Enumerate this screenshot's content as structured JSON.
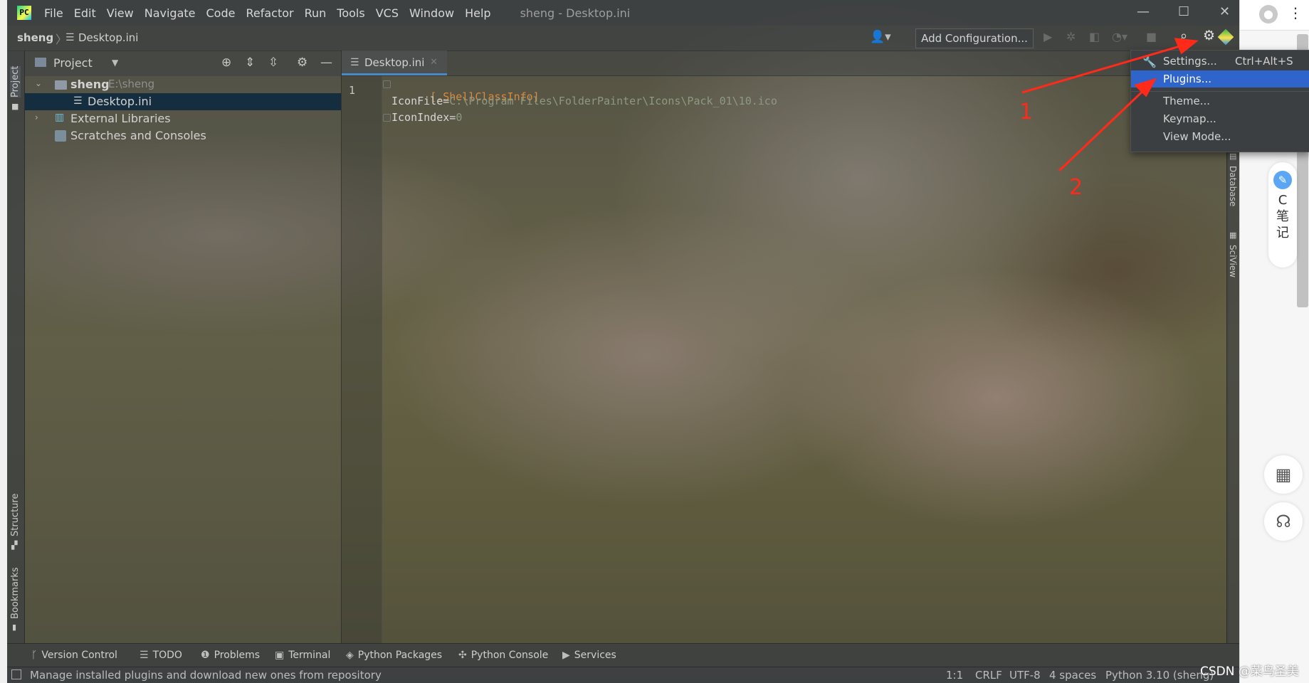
{
  "window": {
    "title": "sheng - Desktop.ini",
    "app_logo": "PC",
    "minimize": "—",
    "maximize": "☐",
    "close": "✕"
  },
  "menu": [
    "File",
    "Edit",
    "View",
    "Navigate",
    "Code",
    "Refactor",
    "Run",
    "Tools",
    "VCS",
    "Window",
    "Help"
  ],
  "navbar": {
    "root": "sheng",
    "file": "Desktop.ini",
    "add_configuration": "Add Configuration..."
  },
  "left_strip": {
    "project": "Project",
    "structure": "Structure",
    "bookmarks": "Bookmarks"
  },
  "project_panel": {
    "title": "Project",
    "tree": [
      {
        "label": "sheng",
        "path": "E:\\sheng"
      },
      {
        "label": "Desktop.ini"
      },
      {
        "label": "External Libraries"
      },
      {
        "label": "Scratches and Consoles"
      }
    ]
  },
  "editor": {
    "tab_label": "Desktop.ini",
    "line_number": "1",
    "lines": [
      {
        "section": "[.ShellClassInfo]"
      },
      {
        "key": "IconFile",
        "eq": "=",
        "value": "C:\\Program Files\\FolderPainter\\Icons\\Pack_01\\10.ico"
      },
      {
        "key": "IconIndex",
        "eq": "=",
        "value": "0"
      }
    ]
  },
  "right_strip": {
    "database": "Database",
    "sciview": "SciView"
  },
  "settings_menu": {
    "items": [
      {
        "label": "Settings...",
        "shortcut": "Ctrl+Alt+S",
        "icon": "wrench-icon"
      },
      {
        "label": "Plugins..."
      },
      {
        "label": "Theme..."
      },
      {
        "label": "Keymap..."
      },
      {
        "label": "View Mode..."
      }
    ]
  },
  "bottom_tabs": [
    "Version Control",
    "TODO",
    "Problems",
    "Terminal",
    "Python Packages",
    "Python Console",
    "Services"
  ],
  "status": {
    "message": "Manage installed plugins and download new ones from repository",
    "position": "1:1",
    "line_sep": "CRLF",
    "encoding": "UTF-8",
    "indent": "4 spaces",
    "interpreter": "Python 3.10 (sheng)"
  },
  "annotations": {
    "marker_1": "1",
    "marker_2": "2",
    "color": "#ff2a1a"
  },
  "browser_side": {
    "card_letter": "C",
    "card_text_1": "笔",
    "card_text_2": "记",
    "watermark": "CSDN @菜鸟圣美"
  },
  "colors": {
    "selection": "#2f65ca",
    "section_text": "#d98a3d",
    "accent_tab": "#4a88c7"
  }
}
